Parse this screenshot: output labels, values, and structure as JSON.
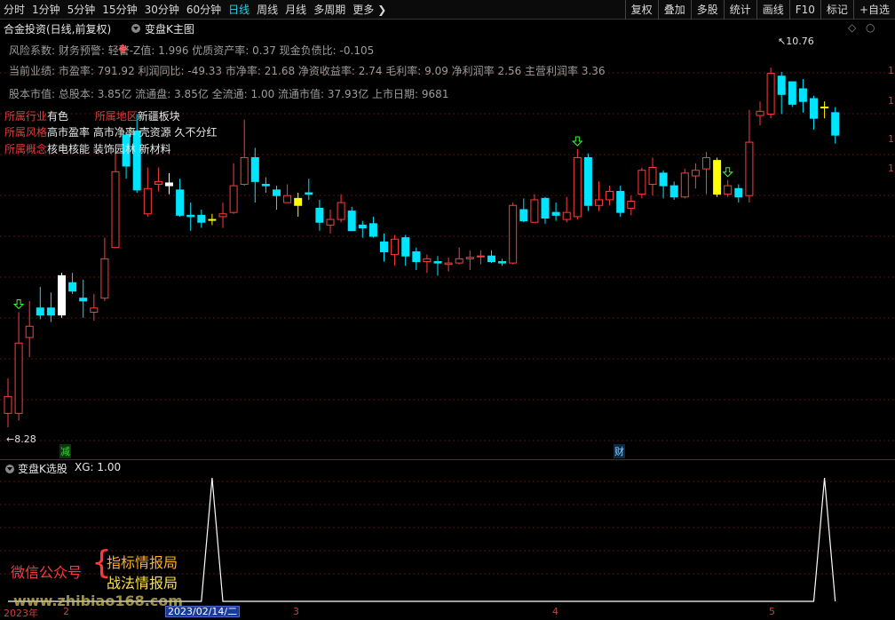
{
  "periods": [
    {
      "label": "分时"
    },
    {
      "label": "1分钟"
    },
    {
      "label": "5分钟"
    },
    {
      "label": "15分钟"
    },
    {
      "label": "30分钟"
    },
    {
      "label": "60分钟"
    },
    {
      "label": "日线",
      "active": true
    },
    {
      "label": "周线"
    },
    {
      "label": "月线"
    },
    {
      "label": "多周期"
    },
    {
      "label": "更多"
    }
  ],
  "more_arrow": "❯",
  "tools": [
    "复权",
    "叠加",
    "多股",
    "统计",
    "画线",
    "F10",
    "标记",
    "+自选"
  ],
  "title": {
    "stock": "合金投资(日线,前复权)",
    "indicator": "变盘K主图"
  },
  "right_icons": {
    "diamond": "◇",
    "circle": "○"
  },
  "info_lines": [
    "风险系数: 财务预警: 轻警-Z值: 1.996 优质资产率: 0.37 现金负债比: -0.105",
    "当前业绩: 市盈率: 791.92 利润同比: -49.33 市净率: 21.68 净资收益率: 2.74 毛利率: 9.09 净利润率 2.56 主营利润率 3.36",
    "股本市值: 总股本: 3.85亿 流通盘: 3.85亿 全流通: 1.00 流通市值: 37.93亿 上市日期: 9681"
  ],
  "tags": [
    {
      "k1": "所属行业",
      "v1": "有色",
      "k2": "所属地区",
      "v2": "新疆板块"
    },
    {
      "k1": "所属风格",
      "v1": "高市盈率 高市净率 壳资源 久不分红"
    },
    {
      "k1": "所属概念",
      "v1": "核电核能 装饰园林 新材料"
    }
  ],
  "price_labels": {
    "high": "10.76",
    "low": "8.28"
  },
  "markers": {
    "jian": "减",
    "cai": "财"
  },
  "sub": {
    "title": "变盘K选股",
    "xg": "XG: 1.00"
  },
  "watermark": {
    "wechat": "微信公众号",
    "line1": "指标情报局",
    "line2": "战法情报局",
    "url": "www.zhibiao168.com"
  },
  "xaxis": {
    "year": "2023年",
    "m2": "2",
    "date": "2023/02/14/二",
    "m3": "3",
    "m4": "4",
    "m5": "5"
  },
  "colors": {
    "up": "#ff3c3c",
    "down": "#00e5ff",
    "special": "#ffff00",
    "signal": "#30ff30"
  },
  "chart_data": {
    "type": "candlestick",
    "candles": [
      {
        "o": 8.3,
        "c": 8.42,
        "h": 8.55,
        "l": 8.2
      },
      {
        "o": 8.3,
        "c": 8.8,
        "h": 9.02,
        "l": 8.25
      },
      {
        "o": 8.84,
        "c": 8.92,
        "h": 9.1,
        "l": 8.7
      },
      {
        "o": 9.05,
        "c": 9.0,
        "h": 9.2,
        "l": 8.97
      },
      {
        "o": 9.05,
        "c": 9.0,
        "h": 9.16,
        "l": 8.95
      },
      {
        "o": 9.0,
        "c": 9.28,
        "h": 9.3,
        "l": 8.98
      },
      {
        "o": 9.23,
        "c": 9.17,
        "h": 9.3,
        "l": 9.15
      },
      {
        "o": 9.12,
        "c": 9.1,
        "h": 9.25,
        "l": 8.98
      },
      {
        "o": 9.02,
        "c": 9.05,
        "h": 9.15,
        "l": 8.96
      },
      {
        "o": 9.12,
        "c": 9.4,
        "h": 9.55,
        "l": 9.1
      },
      {
        "o": 9.48,
        "c": 10.02,
        "h": 10.2,
        "l": 9.48
      },
      {
        "o": 10.28,
        "c": 10.06,
        "h": 10.3,
        "l": 9.97
      },
      {
        "o": 10.31,
        "c": 9.89,
        "h": 10.43,
        "l": 9.87
      },
      {
        "o": 9.72,
        "c": 9.9,
        "h": 10.05,
        "l": 9.7
      },
      {
        "o": 9.93,
        "c": 9.95,
        "h": 10.05,
        "l": 9.88
      },
      {
        "o": 9.94,
        "c": 9.92,
        "h": 10.01,
        "l": 9.86
      },
      {
        "o": 9.89,
        "c": 9.71,
        "h": 9.97,
        "l": 9.7
      },
      {
        "o": 9.71,
        "c": 9.7,
        "h": 9.8,
        "l": 9.6
      },
      {
        "o": 9.71,
        "c": 9.66,
        "h": 9.75,
        "l": 9.62
      },
      {
        "o": 9.68,
        "c": 9.68,
        "h": 9.72,
        "l": 9.64
      },
      {
        "o": 9.7,
        "c": 9.72,
        "h": 9.8,
        "l": 9.62
      },
      {
        "o": 9.73,
        "c": 9.92,
        "h": 10.08,
        "l": 9.72
      },
      {
        "o": 9.93,
        "c": 10.12,
        "h": 10.39,
        "l": 9.92
      },
      {
        "o": 10.12,
        "c": 9.95,
        "h": 10.19,
        "l": 9.8
      },
      {
        "o": 9.93,
        "c": 9.92,
        "h": 9.98,
        "l": 9.87
      },
      {
        "o": 9.89,
        "c": 9.85,
        "h": 9.92,
        "l": 9.75
      },
      {
        "o": 9.8,
        "c": 9.85,
        "h": 9.93,
        "l": 9.8
      },
      {
        "o": 9.83,
        "c": 9.78,
        "h": 9.87,
        "l": 9.7
      },
      {
        "o": 9.87,
        "c": 9.86,
        "h": 9.97,
        "l": 9.82
      },
      {
        "o": 9.76,
        "c": 9.66,
        "h": 9.82,
        "l": 9.6
      },
      {
        "o": 9.64,
        "c": 9.68,
        "h": 9.75,
        "l": 9.58
      },
      {
        "o": 9.68,
        "c": 9.8,
        "h": 9.86,
        "l": 9.66
      },
      {
        "o": 9.74,
        "c": 9.6,
        "h": 9.77,
        "l": 9.6
      },
      {
        "o": 9.64,
        "c": 9.62,
        "h": 9.67,
        "l": 9.55
      },
      {
        "o": 9.65,
        "c": 9.56,
        "h": 9.7,
        "l": 9.55
      },
      {
        "o": 9.52,
        "c": 9.45,
        "h": 9.58,
        "l": 9.38
      },
      {
        "o": 9.43,
        "c": 9.54,
        "h": 9.57,
        "l": 9.35
      },
      {
        "o": 9.55,
        "c": 9.42,
        "h": 9.57,
        "l": 9.35
      },
      {
        "o": 9.45,
        "c": 9.38,
        "h": 9.48,
        "l": 9.32
      },
      {
        "o": 9.38,
        "c": 9.4,
        "h": 9.43,
        "l": 9.3
      },
      {
        "o": 9.38,
        "c": 9.37,
        "h": 9.42,
        "l": 9.28
      },
      {
        "o": 9.36,
        "c": 9.37,
        "h": 9.41,
        "l": 9.31
      },
      {
        "o": 9.37,
        "c": 9.4,
        "h": 9.48,
        "l": 9.36
      },
      {
        "o": 9.4,
        "c": 9.41,
        "h": 9.46,
        "l": 9.32
      },
      {
        "o": 9.42,
        "c": 9.42,
        "h": 9.46,
        "l": 9.36
      },
      {
        "o": 9.42,
        "c": 9.38,
        "h": 9.46,
        "l": 9.37
      },
      {
        "o": 9.38,
        "c": 9.37,
        "h": 9.4,
        "l": 9.35
      },
      {
        "o": 9.37,
        "c": 9.78,
        "h": 9.8,
        "l": 9.36
      },
      {
        "o": 9.75,
        "c": 9.67,
        "h": 9.83,
        "l": 9.66
      },
      {
        "o": 9.66,
        "c": 9.82,
        "h": 9.86,
        "l": 9.66
      },
      {
        "o": 9.83,
        "c": 9.69,
        "h": 9.84,
        "l": 9.65
      },
      {
        "o": 9.73,
        "c": 9.71,
        "h": 9.8,
        "l": 9.67
      },
      {
        "o": 9.68,
        "c": 9.73,
        "h": 9.84,
        "l": 9.66
      },
      {
        "o": 9.7,
        "c": 10.12,
        "h": 10.18,
        "l": 9.68
      },
      {
        "o": 10.12,
        "c": 9.78,
        "h": 10.15,
        "l": 9.74
      },
      {
        "o": 9.78,
        "c": 9.82,
        "h": 9.95,
        "l": 9.74
      },
      {
        "o": 9.82,
        "c": 9.88,
        "h": 9.92,
        "l": 9.78
      },
      {
        "o": 9.88,
        "c": 9.73,
        "h": 9.92,
        "l": 9.7
      },
      {
        "o": 9.76,
        "c": 9.81,
        "h": 9.85,
        "l": 9.71
      },
      {
        "o": 9.86,
        "c": 10.03,
        "h": 10.05,
        "l": 9.83
      },
      {
        "o": 9.93,
        "c": 10.05,
        "h": 10.12,
        "l": 9.85
      },
      {
        "o": 10.01,
        "c": 9.92,
        "h": 10.03,
        "l": 9.83
      },
      {
        "o": 9.92,
        "c": 9.84,
        "h": 9.95,
        "l": 9.82
      },
      {
        "o": 9.84,
        "c": 10.01,
        "h": 10.04,
        "l": 9.83
      },
      {
        "o": 9.99,
        "c": 10.03,
        "h": 10.08,
        "l": 9.9
      },
      {
        "o": 10.04,
        "c": 10.12,
        "h": 10.16,
        "l": 9.86
      },
      {
        "o": 10.1,
        "c": 9.86,
        "h": 10.12,
        "l": 9.84
      },
      {
        "o": 9.86,
        "c": 9.92,
        "h": 9.96,
        "l": 9.84
      },
      {
        "o": 9.9,
        "c": 9.84,
        "h": 9.93,
        "l": 9.8
      },
      {
        "o": 9.85,
        "c": 10.23,
        "h": 10.46,
        "l": 9.8
      },
      {
        "o": 10.42,
        "c": 10.45,
        "h": 10.52,
        "l": 10.35
      },
      {
        "o": 10.43,
        "c": 10.72,
        "h": 10.76,
        "l": 10.4
      },
      {
        "o": 10.7,
        "c": 10.57,
        "h": 10.73,
        "l": 10.43
      },
      {
        "o": 10.66,
        "c": 10.5,
        "h": 10.62,
        "l": 10.48
      },
      {
        "o": 10.61,
        "c": 10.52,
        "h": 10.68,
        "l": 10.44
      },
      {
        "o": 10.54,
        "c": 10.4,
        "h": 10.56,
        "l": 10.32
      },
      {
        "o": 10.48,
        "c": 10.48,
        "h": 10.52,
        "l": 10.4
      },
      {
        "o": 10.44,
        "c": 10.28,
        "h": 10.48,
        "l": 10.22
      }
    ],
    "special_yellow": [
      19,
      27,
      66,
      76
    ],
    "special_white": [
      5,
      15
    ],
    "signal_arrows": [
      1,
      53,
      67
    ],
    "xg_spikes": [
      19,
      76
    ],
    "ylim": [
      8.1,
      10.85
    ]
  }
}
